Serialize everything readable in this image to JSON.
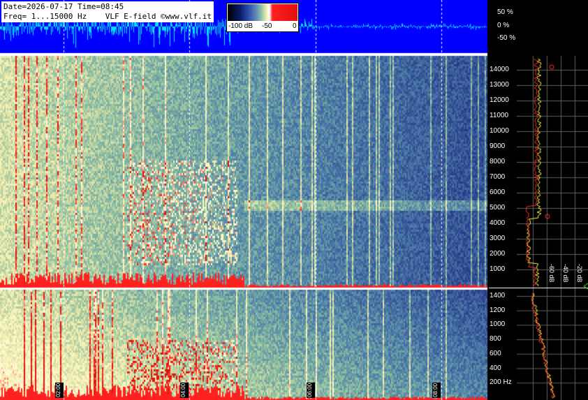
{
  "header": {
    "date_time": "Date=2026-07-17 Time=08:45",
    "freq_line": "Freq= 1...15000 Hz    VLF E-field ©www.vlf.it"
  },
  "scale": {
    "labels": [
      "-100 dB",
      "-50",
      "0"
    ]
  },
  "amplitude_axis": [
    "50 %",
    "0 %",
    "-50 %"
  ],
  "freq_axis_upper": [
    "14000",
    "13000",
    "12000",
    "11000",
    "10000",
    "9000",
    "8000",
    "7000",
    "6000",
    "5000",
    "4000",
    "3000",
    "2000",
    "1000"
  ],
  "freq_axis_lower": [
    "1400",
    "1200",
    "1000",
    "800",
    "600",
    "400",
    "200 Hz"
  ],
  "time_labels": [
    "02:00",
    "04:00",
    "06:00",
    "08:00"
  ],
  "db_labels": [
    "-80 dB",
    "-60 dB",
    "-40 dB",
    "-20 dB"
  ],
  "colors": {
    "waveform_bg": "#0000ff",
    "waveform_trace": "#00e5ff",
    "hot": "#ff2020",
    "warm": "#f4f0b0",
    "cool": "#2e4ea8"
  }
}
